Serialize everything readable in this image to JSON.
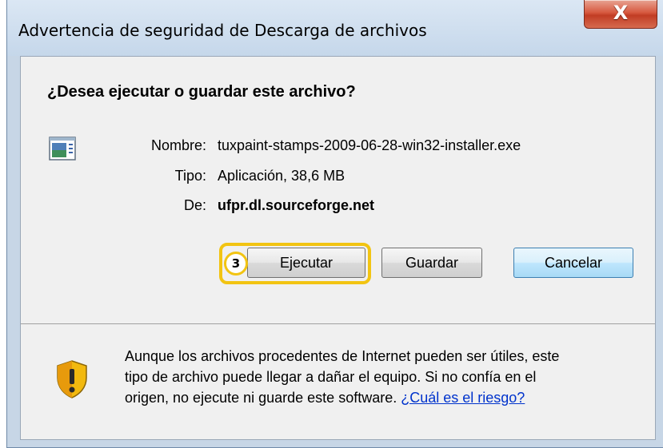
{
  "window": {
    "title": "Advertencia de seguridad de Descarga de archivos",
    "close_glyph": "X"
  },
  "dialog": {
    "question": "¿Desea ejecutar o guardar este archivo?",
    "file_icon": "application-window-icon",
    "name_label": "Nombre:",
    "name_value": "tuxpaint-stamps-2009-06-28-win32-installer.exe",
    "type_label": "Tipo:",
    "type_value": "Aplicación, 38,6 MB",
    "from_label": "De:",
    "from_value": "ufpr.dl.sourceforge.net"
  },
  "buttons": {
    "run": "Ejecutar",
    "save": "Guardar",
    "cancel": "Cancelar"
  },
  "annotation": {
    "step_number": "3",
    "highlight_color": "#f2c412"
  },
  "warning": {
    "icon": "security-shield-icon",
    "text_line1": "Aunque los archivos procedentes de Internet pueden ser útiles, este",
    "text_line2": "tipo de archivo puede llegar a dañar el equipo. Si no confía en el",
    "text_line3": "origen, no ejecute ni guarde este software.",
    "risk_link": "¿Cuál es el riesgo?"
  }
}
